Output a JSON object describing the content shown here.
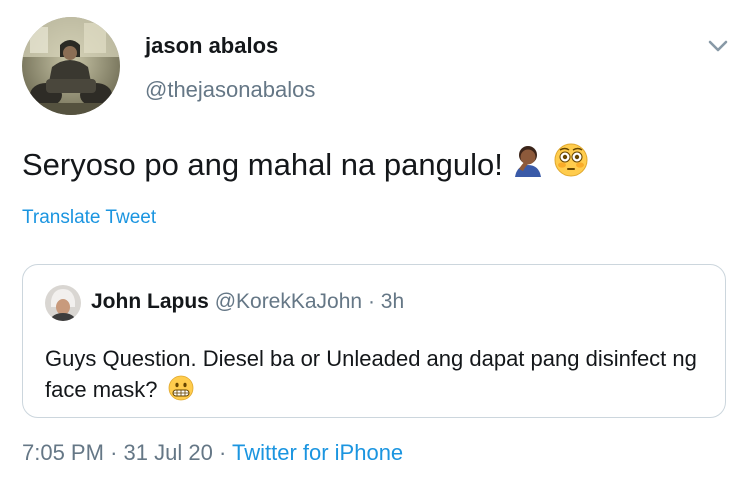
{
  "author": {
    "display_name": "jason abalos",
    "handle": "@thejasonabalos"
  },
  "tweet": {
    "text": "Seryoso po ang mahal na pangulo!",
    "emojis": [
      "man-facepalming-icon",
      "flushed-face-icon"
    ],
    "translate_label": "Translate Tweet"
  },
  "quoted_tweet": {
    "display_name": "John Lapus",
    "handle": "@KorekKaJohn",
    "separator": "·",
    "time": "3h",
    "text": "Guys Question. Diesel ba or Unleaded ang dapat pang disinfect ng face mask?",
    "emoji": "grimacing-face-icon"
  },
  "meta": {
    "time": "7:05 PM",
    "separator": "·",
    "date": "31 Jul 20",
    "source": "Twitter for iPhone"
  },
  "colors": {
    "text": "#14171a",
    "muted": "#657786",
    "link": "#1b95e0",
    "border": "#ccd6dd"
  }
}
